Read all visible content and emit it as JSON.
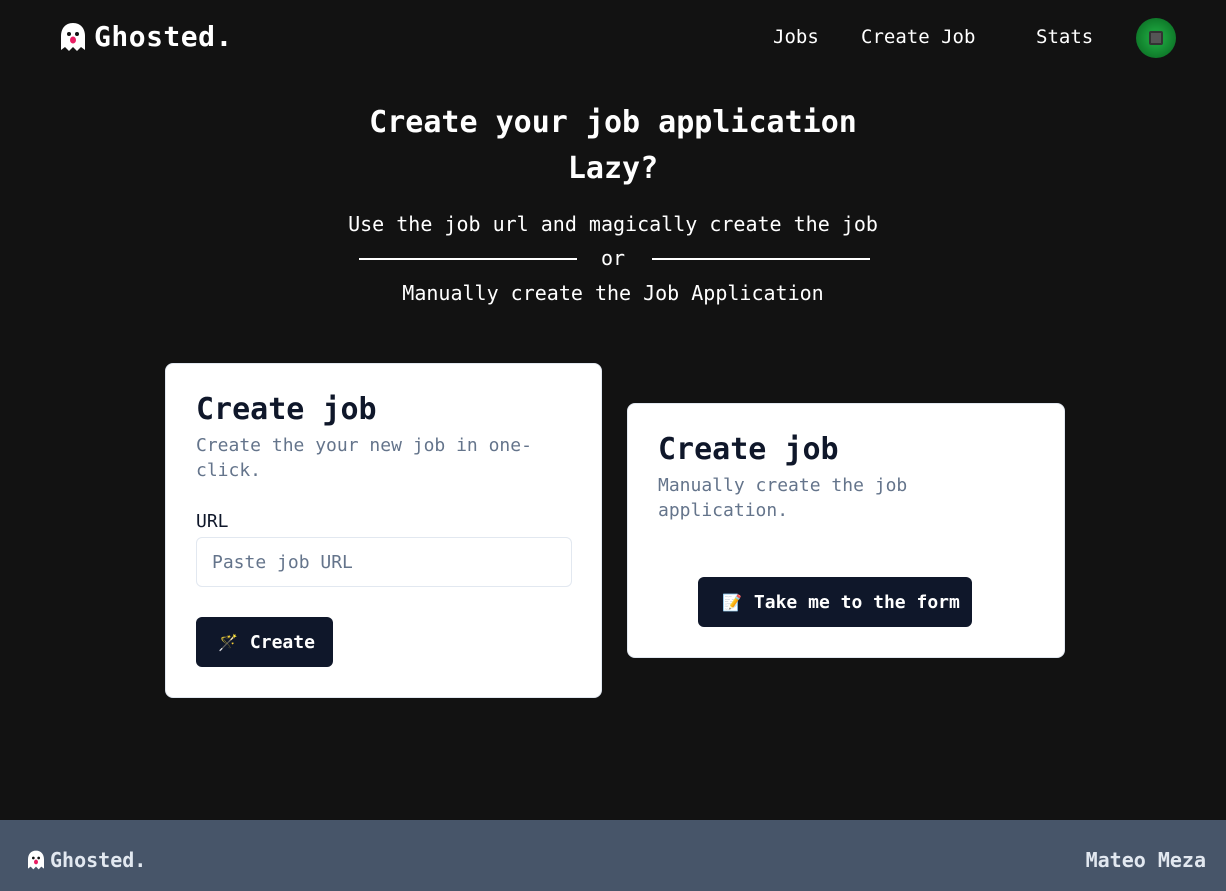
{
  "nav": {
    "brand": "Ghosted.",
    "links": [
      "Jobs",
      "Create Job",
      "Stats"
    ]
  },
  "hero": {
    "title": "Create your job application",
    "subtitle": "Lazy?",
    "desc_url": "Use the job url and magically create the job",
    "or": "or",
    "desc_manual": "Manually create the Job Application"
  },
  "url_card": {
    "title": "Create job",
    "description": "Create the your new job in one-click.",
    "label": "URL",
    "input_value": "",
    "input_placeholder": "Paste job URL",
    "button_icon": "🪄",
    "button_label": "Create"
  },
  "manual_card": {
    "title": "Create job",
    "description": "Manually create the job application.",
    "button_icon": "📝",
    "button_label": "Take me to the form"
  },
  "footer": {
    "brand": "Ghosted.",
    "author": "Mateo Meza"
  },
  "colors": {
    "background": "#121212",
    "button": "#0f172a",
    "footer": "#475569",
    "ghost_accent": "#e91e63"
  }
}
